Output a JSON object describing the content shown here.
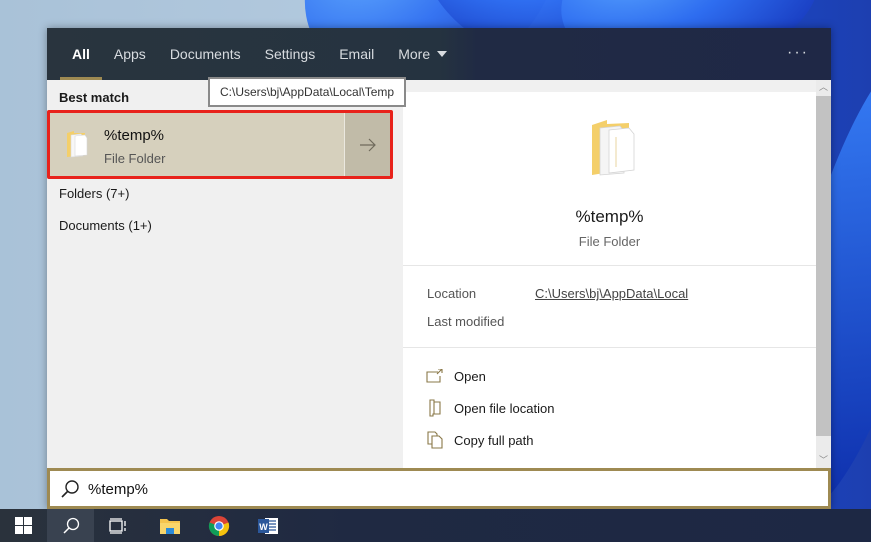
{
  "search_window": {
    "tabs": [
      {
        "label": "All",
        "active": true
      },
      {
        "label": "Apps",
        "active": false
      },
      {
        "label": "Documents",
        "active": false
      },
      {
        "label": "Settings",
        "active": false
      },
      {
        "label": "Email",
        "active": false
      },
      {
        "label": "More",
        "active": false
      }
    ],
    "more_options_icon": "ellipsis-icon",
    "tooltip": "C:\\Users\\bj\\AppData\\Local\\Temp",
    "left_pane": {
      "best_match_label": "Best match",
      "best_match": {
        "title": "%temp%",
        "subtitle": "File Folder",
        "icon": "folder-icon",
        "arrow_icon": "arrow-right-icon"
      },
      "groups": [
        {
          "label": "Folders (7+)"
        },
        {
          "label": "Documents (1+)"
        }
      ]
    },
    "right_pane": {
      "title": "%temp%",
      "subtitle": "File Folder",
      "details": {
        "location_label": "Location",
        "location_value": "C:\\Users\\bj\\AppData\\Local",
        "last_modified_label": "Last modified"
      },
      "actions": [
        {
          "label": "Open",
          "icon": "open-icon"
        },
        {
          "label": "Open file location",
          "icon": "file-location-icon"
        },
        {
          "label": "Copy full path",
          "icon": "copy-icon"
        }
      ]
    },
    "search_box": {
      "value": "%temp%",
      "icon": "search-icon"
    }
  },
  "taskbar": {
    "items": [
      {
        "name": "start",
        "icon": "windows-icon"
      },
      {
        "name": "search",
        "icon": "search-icon",
        "active": true
      },
      {
        "name": "task-view",
        "icon": "task-view-icon"
      },
      {
        "name": "file-explorer",
        "icon": "file-explorer-icon"
      },
      {
        "name": "chrome",
        "icon": "chrome-icon"
      },
      {
        "name": "word",
        "icon": "word-icon"
      }
    ]
  },
  "colors": {
    "accent": "#9e8a52",
    "highlight_border": "#e8221b",
    "selected_bg": "#d6d0bd"
  }
}
